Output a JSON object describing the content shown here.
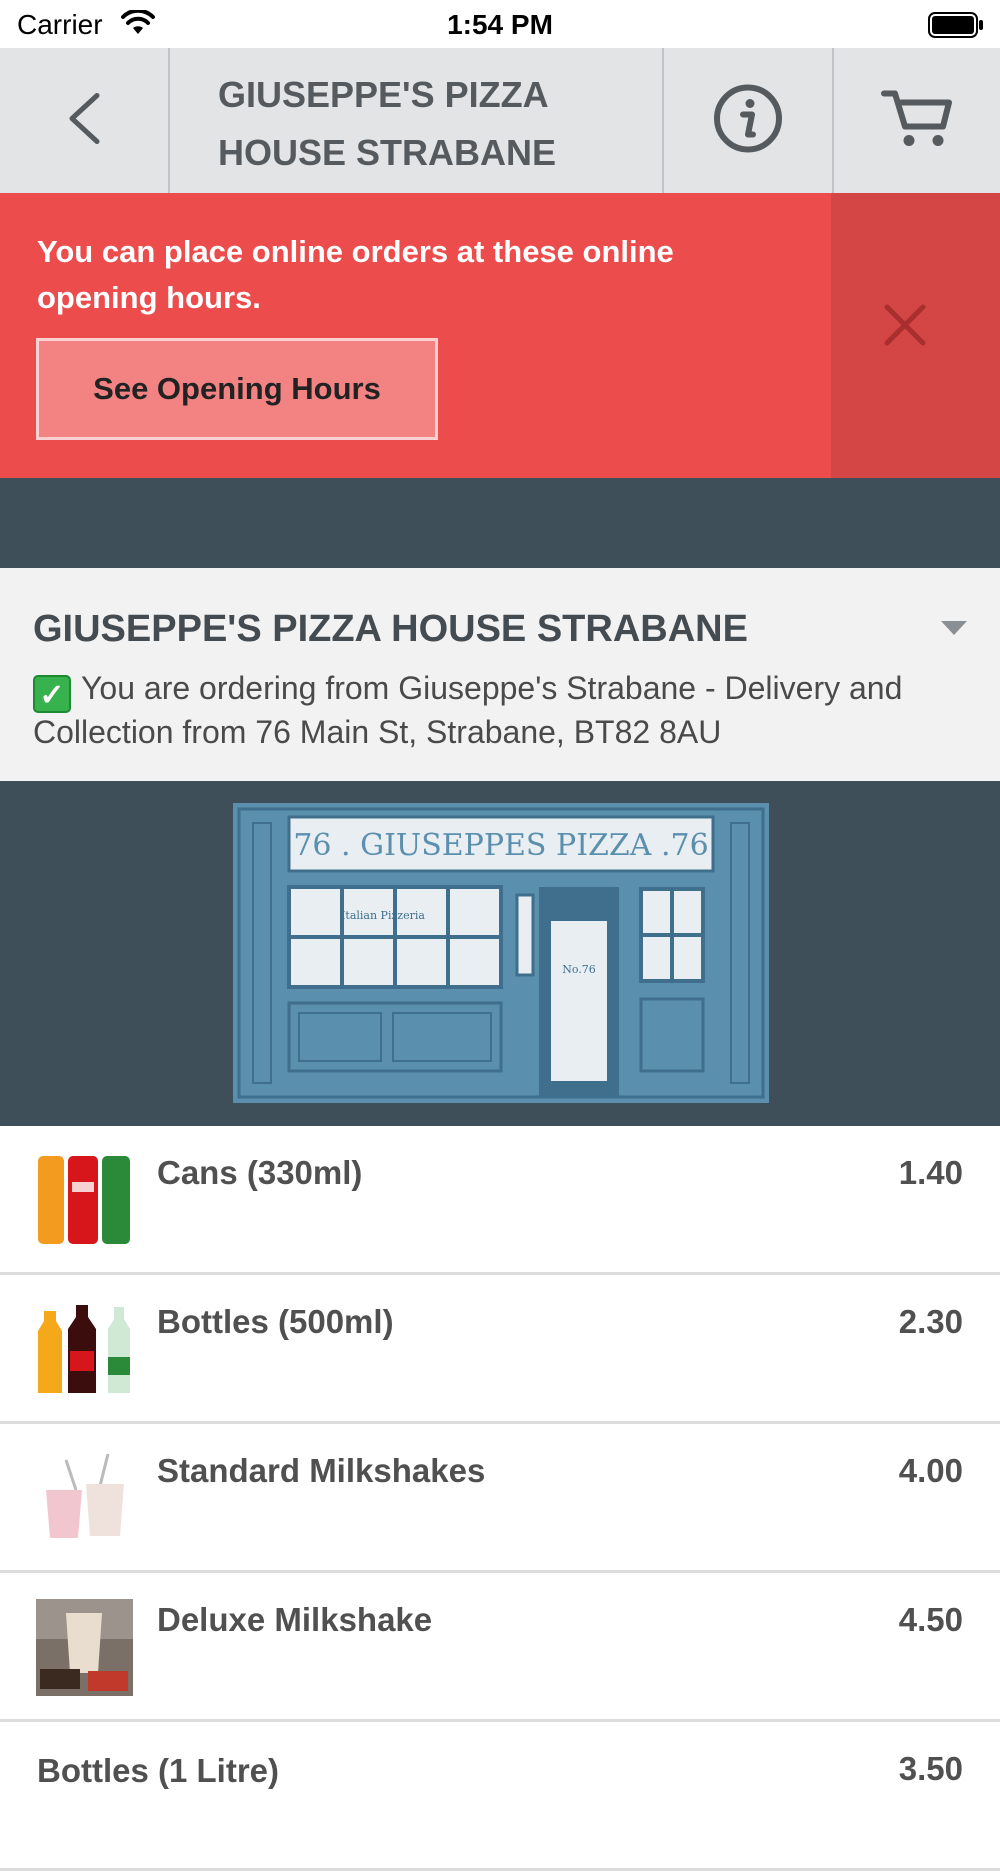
{
  "status_bar": {
    "carrier": "Carrier",
    "time": "1:54 PM"
  },
  "nav": {
    "title": "GIUSEPPE'S PIZZA HOUSE STRABANE"
  },
  "alert": {
    "message": "You can place online orders at these online opening hours.",
    "button_label": "See Opening Hours"
  },
  "restaurant": {
    "name": "GIUSEPPE'S PIZZA HOUSE STRABANE",
    "description": "You are ordering from Giuseppe's Strabane - Delivery and Collection from 76 Main St, Strabane, BT82 8AU"
  },
  "hero": {
    "sign_text": "76 . GIUSEPPES PIZZA .76",
    "window_text": "Italian Pizzeria",
    "door_text": "No.76"
  },
  "menu": {
    "items": [
      {
        "name": "Cans (330ml)",
        "price": "1.40",
        "icon": "cans-thumbnail"
      },
      {
        "name": "Bottles (500ml)",
        "price": "2.30",
        "icon": "bottles-thumbnail"
      },
      {
        "name": "Standard Milkshakes",
        "price": "4.00",
        "icon": "milkshakes-thumbnail"
      },
      {
        "name": "Deluxe Milkshake",
        "price": "4.50",
        "icon": "deluxe-milkshake-thumbnail"
      },
      {
        "name": "Bottles (1 Litre)",
        "price": "3.50"
      }
    ]
  },
  "colors": {
    "nav_bg": "#e2e4e5",
    "alert_bg": "#ec4c4c",
    "alert_close_bg": "#d44545",
    "dark_bg": "#3f4f59",
    "info_bg": "#f2f2f2"
  }
}
